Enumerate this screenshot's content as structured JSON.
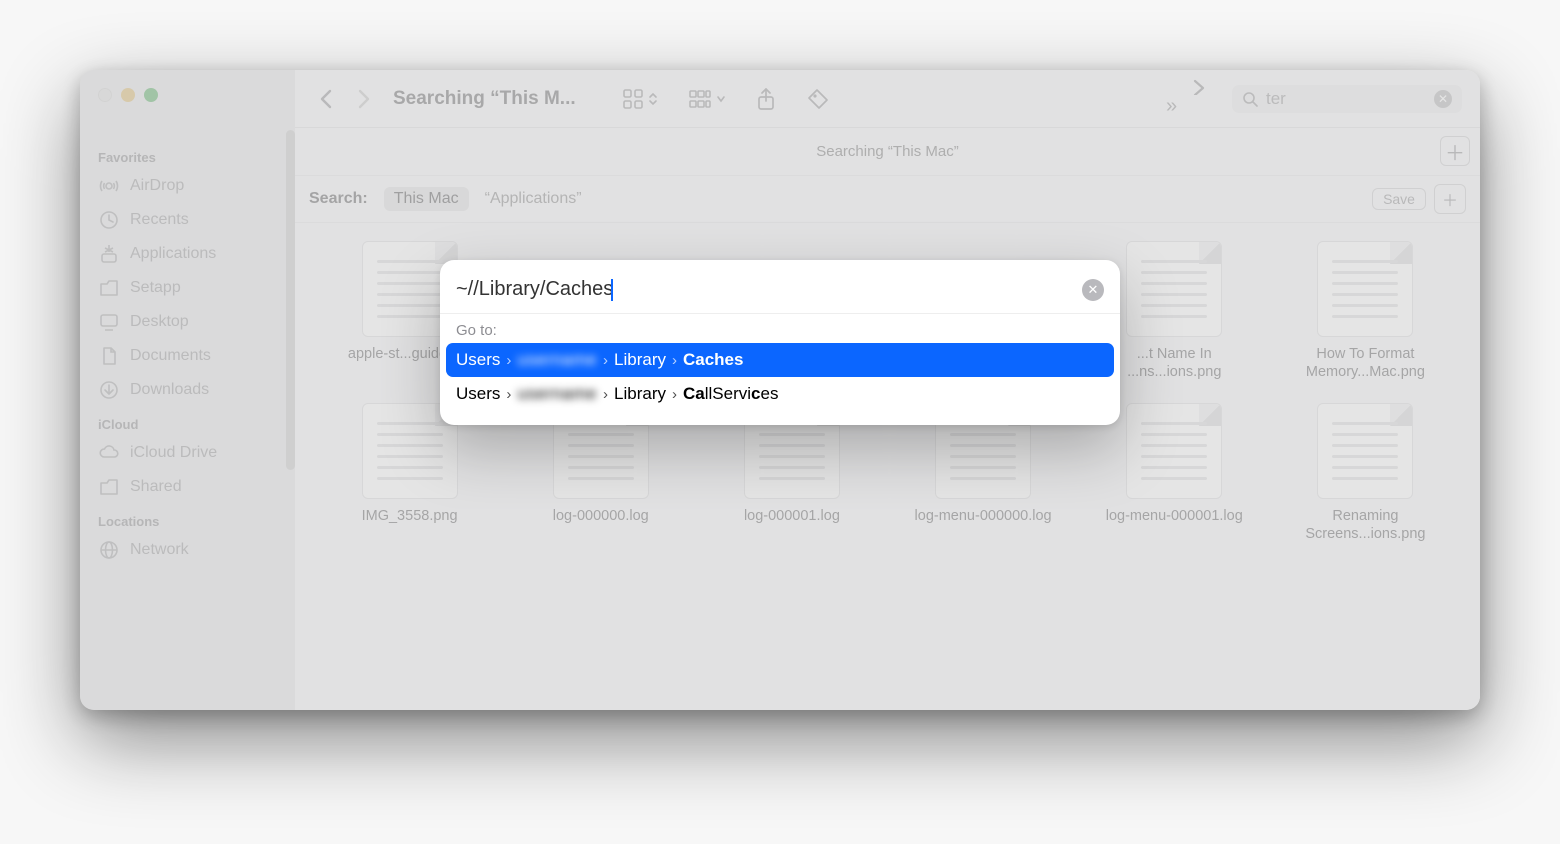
{
  "window": {
    "title": "Searching “This M...",
    "subheading": "Searching “This Mac”",
    "search_query": "ter"
  },
  "sidebar": {
    "sections": [
      {
        "title": "Favorites",
        "items": [
          "AirDrop",
          "Recents",
          "Applications",
          "Setapp",
          "Desktop",
          "Documents",
          "Downloads"
        ]
      },
      {
        "title": "iCloud",
        "items": [
          "iCloud Drive",
          "Shared"
        ]
      },
      {
        "title": "Locations",
        "items": [
          "Network"
        ]
      }
    ]
  },
  "scope": {
    "label": "Search:",
    "selected": "This Mac",
    "alt": "“Applications”",
    "save": "Save"
  },
  "files": {
    "row1": [
      "apple-st...guide.p...",
      "",
      "",
      "",
      "...t Name In ...ns...ions.png",
      "How To Format Memory...Mac.png"
    ],
    "row2": [
      "IMG_3558.png",
      "log-000000.log",
      "log-000001.log",
      "log-menu-000000.log",
      "log-menu-000001.log",
      "Renaming Screens...ions.png"
    ]
  },
  "goto": {
    "input": "~//Library/Caches",
    "label": "Go to:",
    "suggestions": [
      {
        "segments": [
          "Users",
          "[redacted]",
          "Library"
        ],
        "last": "Caches",
        "bold_last": true
      },
      {
        "segments": [
          "Users",
          "[redacted]",
          "Library"
        ],
        "last": "CallServices",
        "bold_spans": [
          "Ca",
          "c"
        ]
      }
    ]
  }
}
